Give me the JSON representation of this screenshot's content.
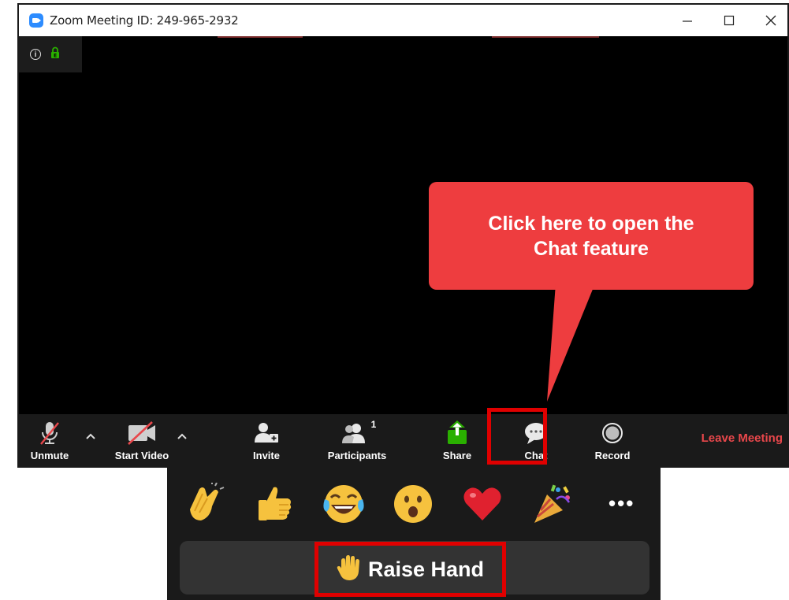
{
  "window": {
    "title": "Zoom Meeting ID: 249-965-2932",
    "minimize_glyph": "—",
    "maximize_glyph": "☐",
    "close_glyph": "✕"
  },
  "info": {
    "info_glyph": "i",
    "lock_icon": "lock-icon"
  },
  "toolbar": {
    "unmute_label": "Unmute",
    "start_video_label": "Start Video",
    "invite_label": "Invite",
    "participants_label": "Participants",
    "participants_count": "1",
    "share_label": "Share",
    "chat_label": "Chat",
    "record_label": "Record",
    "leave_label": "Leave Meeting",
    "caret_glyph": "^"
  },
  "callout": {
    "line1": "Click here to open the",
    "line2": "Chat feature"
  },
  "reactions": {
    "items": [
      "clap-emoji",
      "thumbs-up-emoji",
      "tears-of-joy-emoji",
      "surprised-emoji",
      "heart-emoji",
      "party-popper-emoji"
    ],
    "more_glyph": "•••",
    "raise_hand_label": "Raise Hand"
  },
  "colors": {
    "accent_red": "#e00000",
    "callout_red": "#ee3d3f",
    "leave_red": "#e8474b",
    "share_green": "#2ab000",
    "zoom_blue": "#2d8cff"
  }
}
